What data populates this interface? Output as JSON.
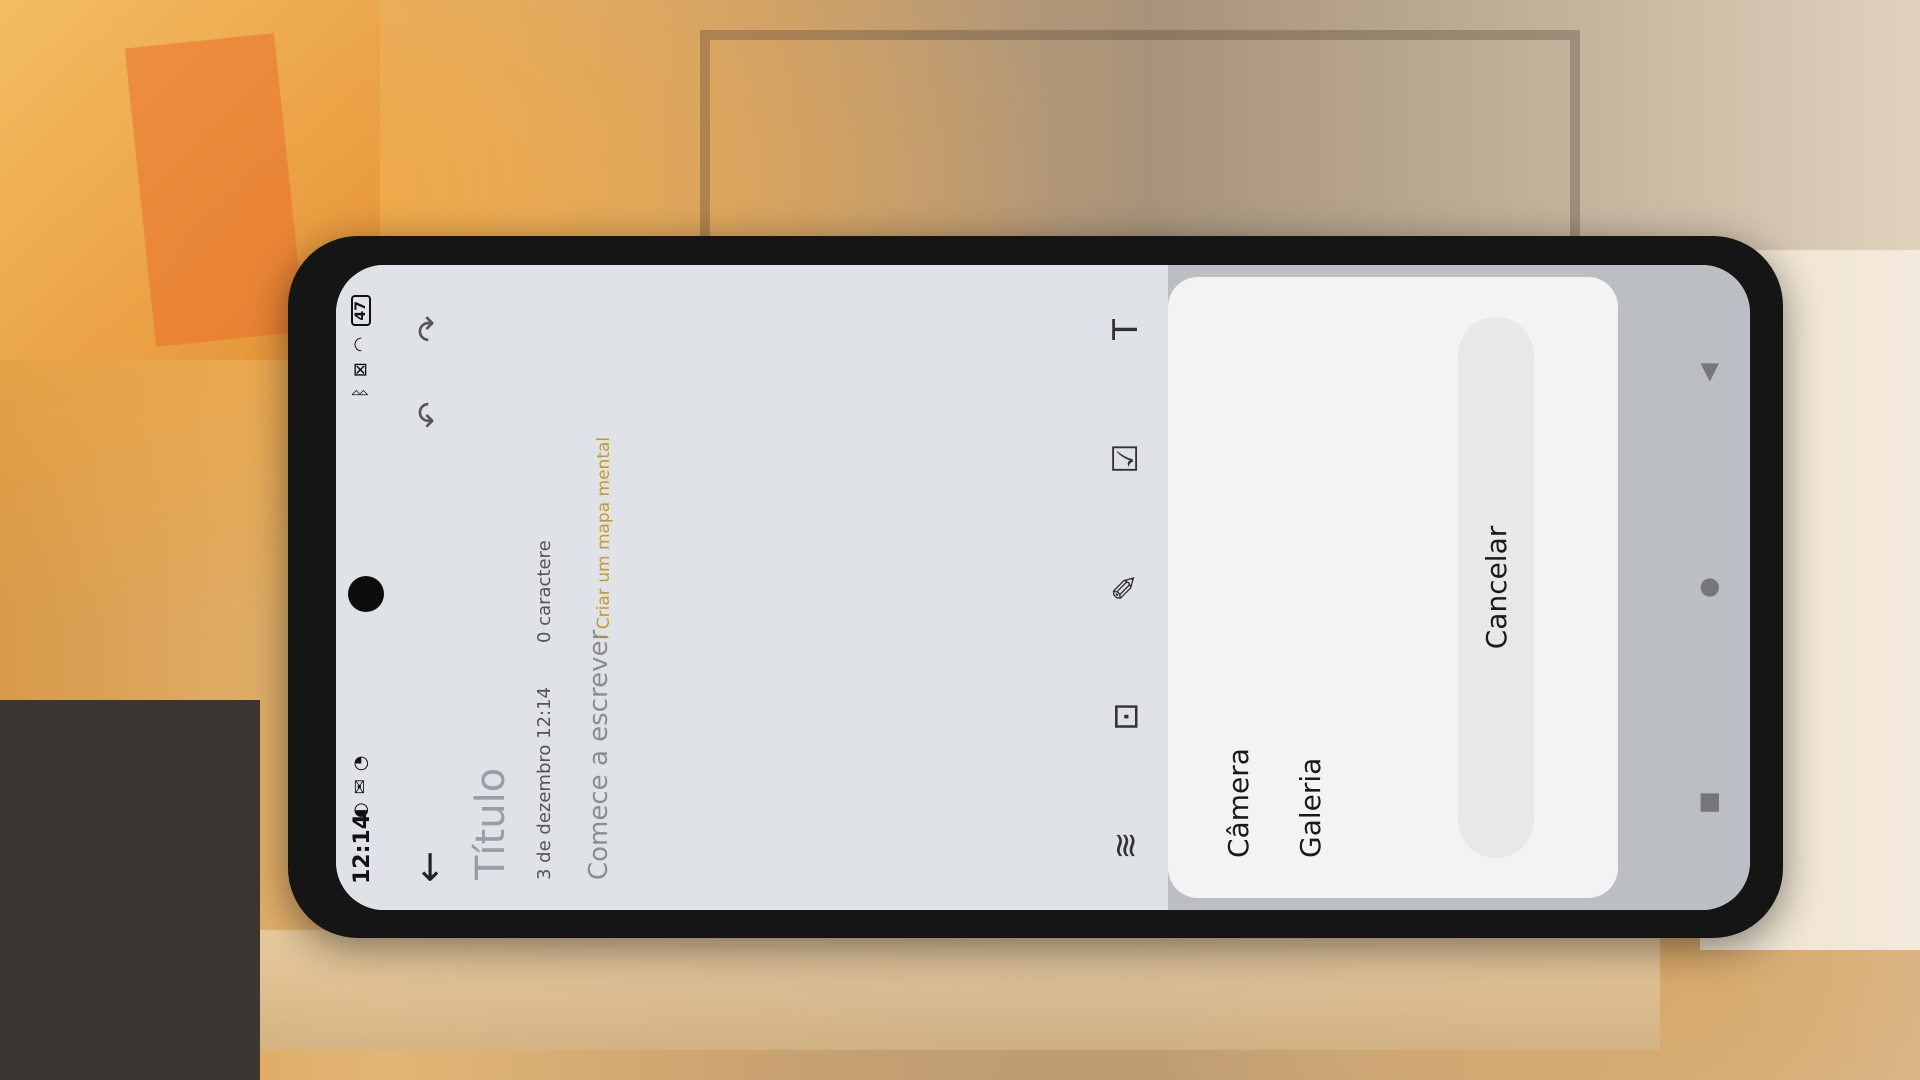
{
  "status_bar": {
    "time": "12:14",
    "left_icons": [
      "notification-icon",
      "mail-icon",
      "sync-icon"
    ],
    "right_icons": [
      "bluetooth-icon",
      "sim-off-icon",
      "wifi-icon"
    ],
    "battery": "47"
  },
  "note": {
    "title_placeholder": "Título",
    "date": "3 de dezembro 12:14",
    "char_count": "0 caractere",
    "body_placeholder": "Comece a escrever",
    "mindmap_link": "Criar um mapa mental"
  },
  "toolbar": {
    "icons": [
      "audio-wave-icon",
      "image-icon",
      "handwriting-icon",
      "checklist-icon",
      "text-format-icon"
    ]
  },
  "sheet": {
    "camera": "Câmera",
    "gallery": "Galeria",
    "cancel": "Cancelar"
  },
  "nav": {
    "icons": [
      "recents-square-icon",
      "home-circle-icon",
      "back-triangle-icon"
    ]
  }
}
